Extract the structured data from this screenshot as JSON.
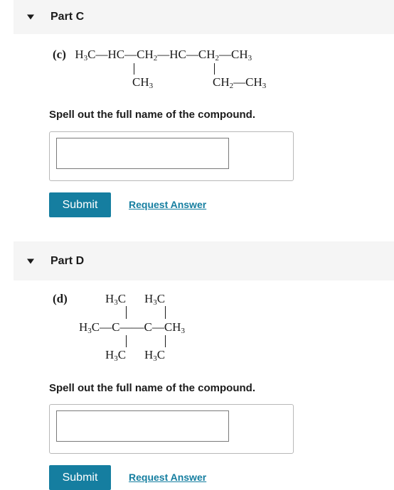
{
  "part_c": {
    "title": "Part C",
    "label": "(c)",
    "formula": {
      "h3c": "H",
      "h3c_sub": "3",
      "h3c_c": "C",
      "hc1": "HC",
      "ch2a": "CH",
      "ch2a_sub": "2",
      "hc2": "HC",
      "ch2b": "CH",
      "ch2b_sub": "2",
      "ch3": "CH",
      "ch3_sub": "3",
      "branch1": "CH",
      "branch1_sub": "3",
      "branch2a": "CH",
      "branch2a_sub": "2",
      "branch2b": "CH",
      "branch2b_sub": "3",
      "dash": "—"
    },
    "prompt": "Spell out the full name of the compound.",
    "input_value": "",
    "submit_label": "Submit",
    "request_label": "Request Answer"
  },
  "part_d": {
    "title": "Part D",
    "label": "(d)",
    "formula": {
      "top_left": "H",
      "top_left_sub": "3",
      "top_left_c": "C",
      "top_right": "H",
      "top_right_sub": "3",
      "top_right_c": "C",
      "mid_left": "H",
      "mid_left_sub": "3",
      "mid_left_c": "C",
      "c1": "C",
      "c2": "C",
      "mid_right": "CH",
      "mid_right_sub": "3",
      "bot_left": "H",
      "bot_left_sub": "3",
      "bot_left_c": "C",
      "bot_right": "H",
      "bot_right_sub": "3",
      "bot_right_c": "C",
      "dash": "—",
      "long_dash": "——"
    },
    "prompt": "Spell out the full name of the compound.",
    "input_value": "",
    "submit_label": "Submit",
    "request_label": "Request Answer"
  }
}
